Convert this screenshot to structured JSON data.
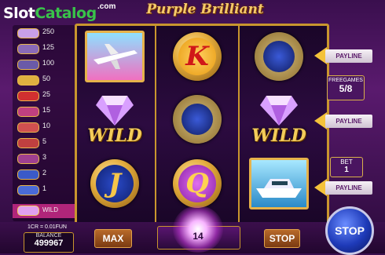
{
  "logo": {
    "slot": "Slot",
    "catalog": "Catalog",
    "com": ".com"
  },
  "title": "Purple Brilliant",
  "paytable": [
    {
      "value": "250"
    },
    {
      "value": "125"
    },
    {
      "value": "100"
    },
    {
      "value": "50"
    },
    {
      "value": "25"
    },
    {
      "value": "15"
    },
    {
      "value": "10"
    },
    {
      "value": "5"
    },
    {
      "value": "3"
    },
    {
      "value": "2"
    },
    {
      "value": "1"
    },
    {
      "value": "WILD"
    }
  ],
  "reels": {
    "r1": [
      "airplane",
      "WILD",
      "J"
    ],
    "r2": [
      "K",
      "watch",
      "Q"
    ],
    "r3": [
      "watch",
      "WILD",
      "yacht"
    ]
  },
  "paylines": [
    "PAYLINE",
    "PAYLINE",
    "PAYLINE"
  ],
  "freegames": {
    "label": "FREEGAMES",
    "value": "5/8"
  },
  "bet": {
    "label": "BET",
    "value": "1"
  },
  "bottom": {
    "coin_value": "1CR = 0.01FUN",
    "balance_label": "BALANCE",
    "balance": "499967",
    "max_label": "MAX",
    "center_value": "14",
    "stop_label": "STOP",
    "stop_big_label": "STOP"
  },
  "colors": {
    "gold": "#c9962e",
    "purple": "#3a0f4e",
    "stop_blue": "#1e3ab8"
  }
}
